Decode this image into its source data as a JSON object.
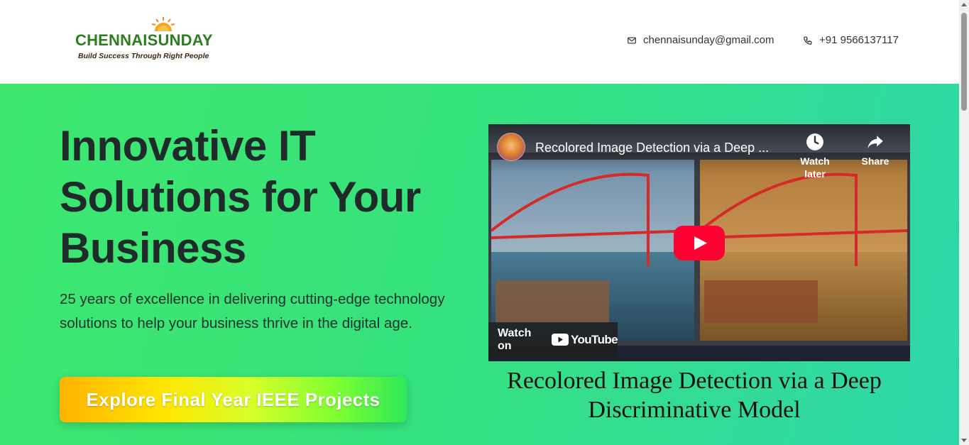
{
  "header": {
    "logo": {
      "name": "CHENNAISUNDAY",
      "tagline": "Build Success Through Right People"
    },
    "email": "chennaisunday@gmail.com",
    "phone": "+91 9566137117",
    "icons": {
      "email": "mail-icon",
      "phone": "phone-icon"
    }
  },
  "hero": {
    "title": "Innovative IT Solutions for Your Business",
    "description": "25 years of excellence in delivering cutting-edge technology solutions to help your business thrive in the digital age.",
    "cta_label": "Explore Final Year IEEE Projects"
  },
  "video": {
    "title": "Recolored Image Detection via a Deep ...",
    "watch_later": "Watch later",
    "share": "Share",
    "watch_on": "Watch on",
    "youtube": "YouTube",
    "caption": "Recolored Image Detection via a Deep Discriminative Model"
  },
  "colors": {
    "brand_green": "#2e7d1f",
    "hero_gradient_start": "#3ee86e",
    "hero_gradient_end": "#2fd6ab",
    "youtube_red": "#ff0033"
  }
}
